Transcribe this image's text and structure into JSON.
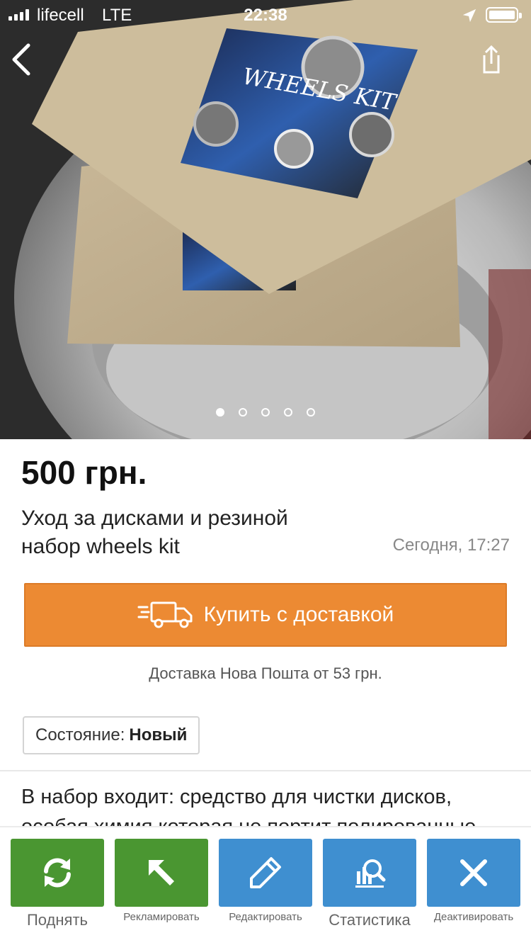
{
  "status_bar": {
    "carrier": "lifecell",
    "network": "LTE",
    "time": "22:38"
  },
  "gallery": {
    "image_count": 5,
    "active_index": 0
  },
  "listing": {
    "price": "500 грн.",
    "title_line1": "Уход за дисками и резиной",
    "title_line2": "набор wheels kit",
    "date": "Сегодня, 17:27",
    "buy_button_label": "Купить с доставкой",
    "delivery_note": "Доставка Нова Пошта от 53 грн.",
    "condition_label": "Состояние:",
    "condition_value": "Новый",
    "description_line1": "В набор входит: средство для чистки дисков,",
    "description_line2": "особая химия которая не портит полированные"
  },
  "actions": [
    {
      "label": "Поднять",
      "icon": "refresh-icon",
      "color": "#4a9631"
    },
    {
      "label": "Рекламировать",
      "icon": "arrow-cursor-icon",
      "color": "#4a9631"
    },
    {
      "label": "Редактировать",
      "icon": "pencil-icon",
      "color": "#3f8fd0"
    },
    {
      "label": "Статистика",
      "icon": "stats-icon",
      "color": "#3f8fd0"
    },
    {
      "label": "Деактивировать",
      "icon": "close-icon",
      "color": "#3f8fd0"
    }
  ],
  "colors": {
    "accent_orange": "#ec8a33",
    "action_green": "#4a9631",
    "action_blue": "#3f8fd0"
  }
}
